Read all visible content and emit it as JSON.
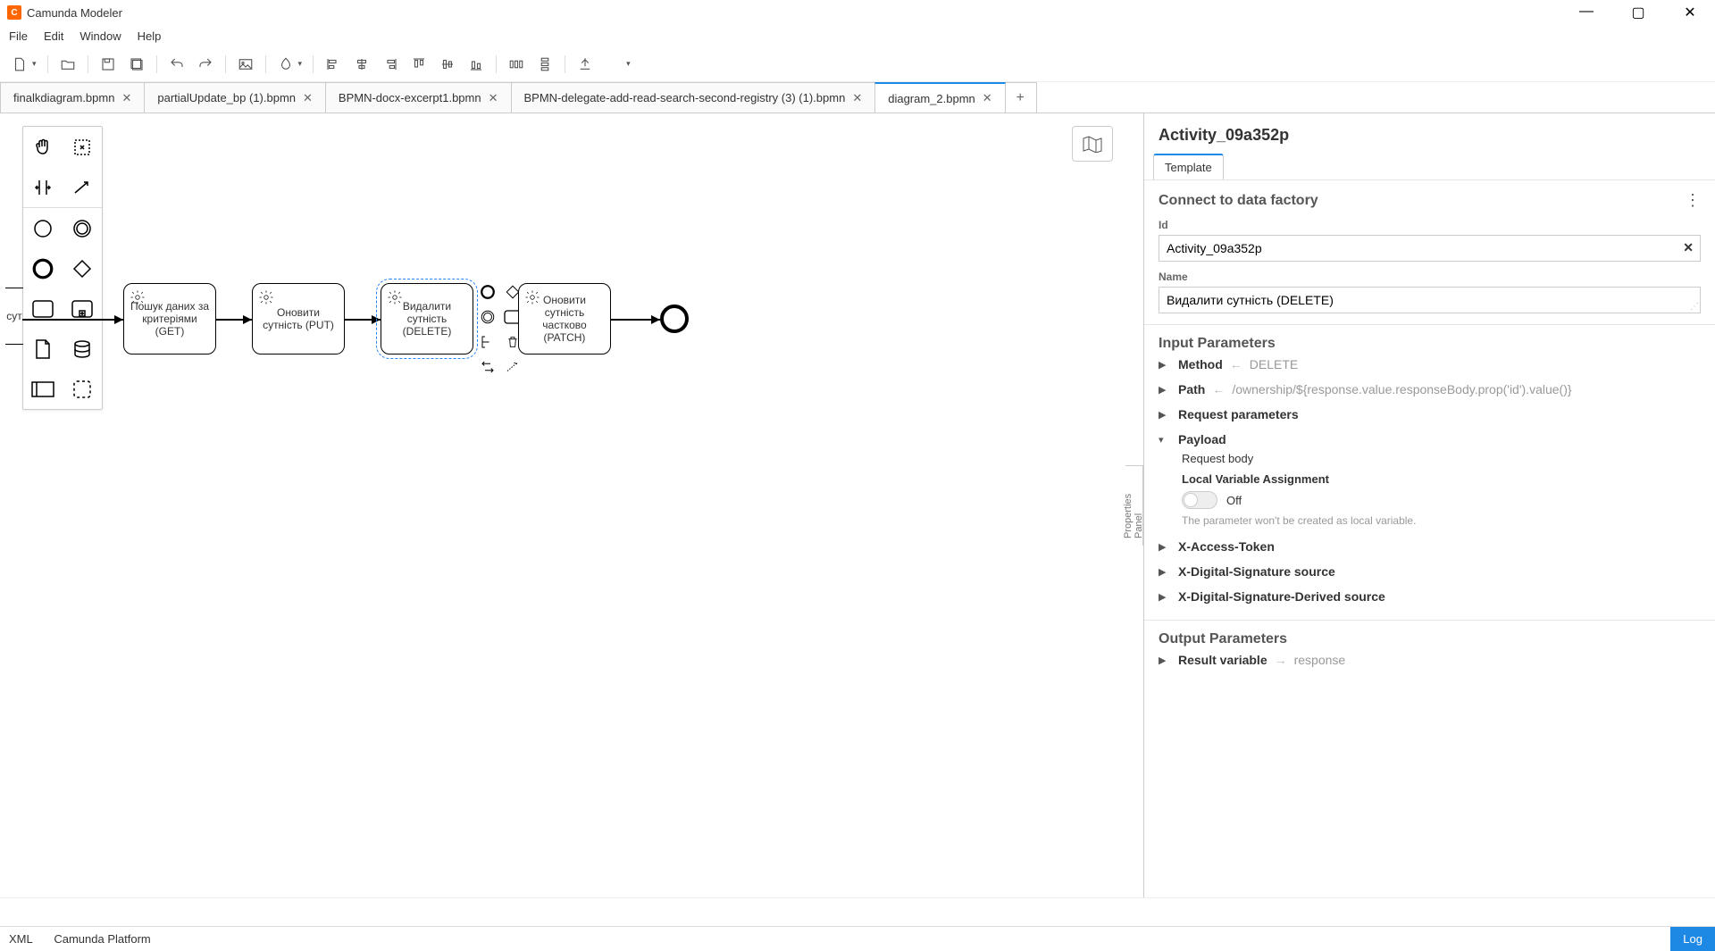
{
  "app": {
    "title": "Camunda Modeler"
  },
  "menu": {
    "file": "File",
    "edit": "Edit",
    "window": "Window",
    "help": "Help"
  },
  "tabs": [
    {
      "label": "finalkdiagram.bpmn"
    },
    {
      "label": "partialUpdate_bp (1).bpmn"
    },
    {
      "label": "BPMN-docx-excerpt1.bpmn"
    },
    {
      "label": "BPMN-delegate-add-read-search-second-registry (3) (1).bpmn"
    },
    {
      "label": "diagram_2.bpmn",
      "active": true
    }
  ],
  "newTab": "+",
  "canvas": {
    "cutTask": "сут",
    "tasks": [
      {
        "label": "Пошук даних за критеріями (GET)"
      },
      {
        "label": "Оновити сутність (PUT)"
      },
      {
        "label": "Видалити сутність (DELETE)",
        "selected": true
      },
      {
        "label": "Оновити сутність частково (PATCH)"
      }
    ]
  },
  "panelHandle": "Properties Panel",
  "panel": {
    "title": "Activity_09a352p",
    "tab": "Template",
    "section": "Connect to data factory",
    "idLabel": "Id",
    "idValue": "Activity_09a352p",
    "nameLabel": "Name",
    "nameValue": "Видалити сутність (DELETE)",
    "inputHeader": "Input Parameters",
    "params": {
      "method": {
        "name": "Method",
        "value": "DELETE"
      },
      "path": {
        "name": "Path",
        "value": "/ownership/${response.value.responseBody.prop('id').value()}"
      },
      "requestParams": {
        "name": "Request parameters"
      },
      "payload": {
        "name": "Payload"
      },
      "requestBody": "Request body",
      "lva": "Local Variable Assignment",
      "lvaState": "Off",
      "lvaHint": "The parameter won't be created as local variable.",
      "xAccess": {
        "name": "X-Access-Token"
      },
      "xSig": {
        "name": "X-Digital-Signature source"
      },
      "xSigDer": {
        "name": "X-Digital-Signature-Derived source"
      }
    },
    "outputHeader": "Output Parameters",
    "output": {
      "name": "Result variable",
      "value": "response"
    }
  },
  "footer": {
    "xml": "XML",
    "platform": "Camunda Platform",
    "log": "Log"
  }
}
